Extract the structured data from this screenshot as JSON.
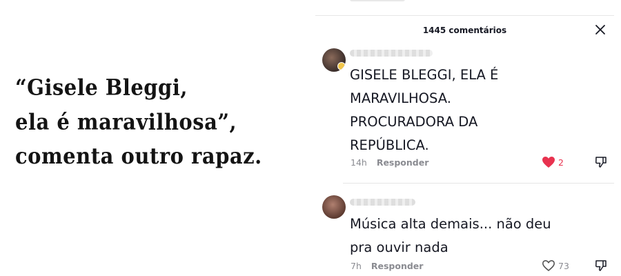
{
  "caption": {
    "lines": [
      "“Gisele Bleggi,",
      "ela é maravilhosa”,",
      "comenta outro rapaz."
    ]
  },
  "comments_panel": {
    "header": "1445 comentários",
    "comments": [
      {
        "text_lines": [
          "GISELE BLEGGI, ELA É",
          "MARAVILHOSA.",
          "PROCURADORA DA",
          "REPÚBLICA."
        ],
        "time": "14h",
        "reply_label": "Responder",
        "likes": "2",
        "liked": true
      },
      {
        "text_lines": [
          "Música alta demais... não deu",
          "pra ouvir nada"
        ],
        "time": "7h",
        "reply_label": "Responder",
        "likes": "73",
        "liked": false
      }
    ]
  },
  "colors": {
    "like_active": "#e8324f",
    "like_inactive": "#8a8b91",
    "text_primary": "#161823",
    "text_secondary": "#8a8b91"
  },
  "icons": [
    "close-icon",
    "heart-filled-icon",
    "heart-outline-icon",
    "thumbs-down-icon"
  ]
}
